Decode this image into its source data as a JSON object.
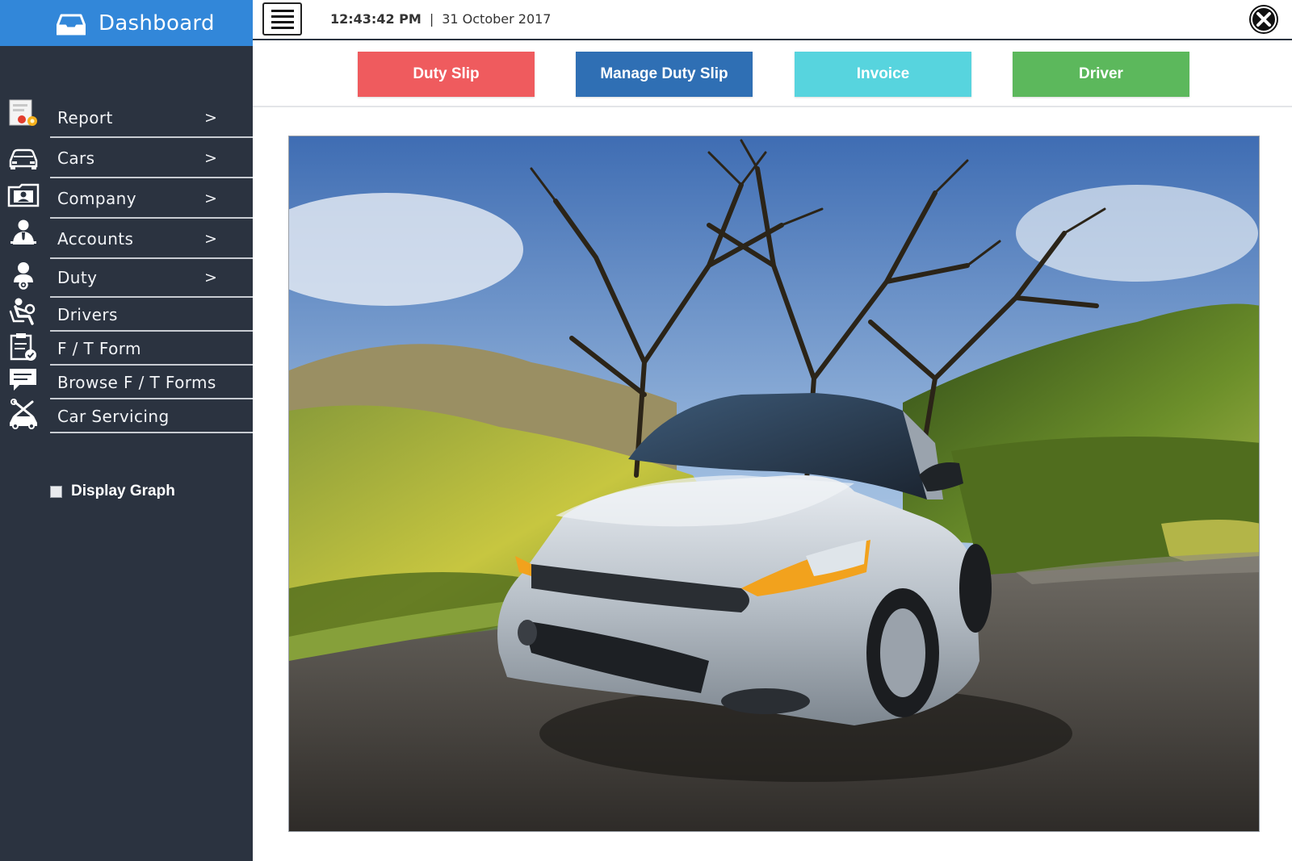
{
  "sidebar": {
    "brand": {
      "title": "Dashboard",
      "icon": "inbox-tray-icon"
    },
    "items": [
      {
        "label": "Report",
        "chevron": ">",
        "icon": "report-document-icon"
      },
      {
        "label": "Cars",
        "chevron": ">",
        "icon": "car-icon"
      },
      {
        "label": "Company",
        "chevron": ">",
        "icon": "id-card-folder-icon"
      },
      {
        "label": "Accounts",
        "chevron": ">",
        "icon": "business-person-icon"
      },
      {
        "label": "Duty",
        "chevron": ">",
        "icon": "user-group-icon"
      },
      {
        "label": "Drivers",
        "chevron": "",
        "icon": "seated-driver-icon"
      },
      {
        "label": "F / T Form",
        "chevron": "",
        "icon": "clipboard-check-icon"
      },
      {
        "label": "Browse F / T Forms",
        "chevron": "",
        "icon": "chat-bubble-icon"
      },
      {
        "label": "Car Servicing",
        "chevron": "",
        "icon": "car-tools-icon"
      }
    ],
    "display_graph": {
      "label": "Display Graph",
      "checked": false
    }
  },
  "topbar": {
    "time": "12:43:42 PM",
    "separator": "|",
    "date": "31 October 2017",
    "menu_icon": "hamburger-menu-icon",
    "close_icon": "close-circle-icon"
  },
  "actions": [
    {
      "label": "Duty Slip",
      "color": "#ef5b5e"
    },
    {
      "label": "Manage Duty Slip",
      "color": "#2f6fb4"
    },
    {
      "label": "Invoice",
      "color": "#57d4de"
    },
    {
      "label": "Driver",
      "color": "#5cb85c"
    }
  ],
  "colors": {
    "sidebar_bg": "#2b3340",
    "brand_bg": "#3287d9"
  }
}
